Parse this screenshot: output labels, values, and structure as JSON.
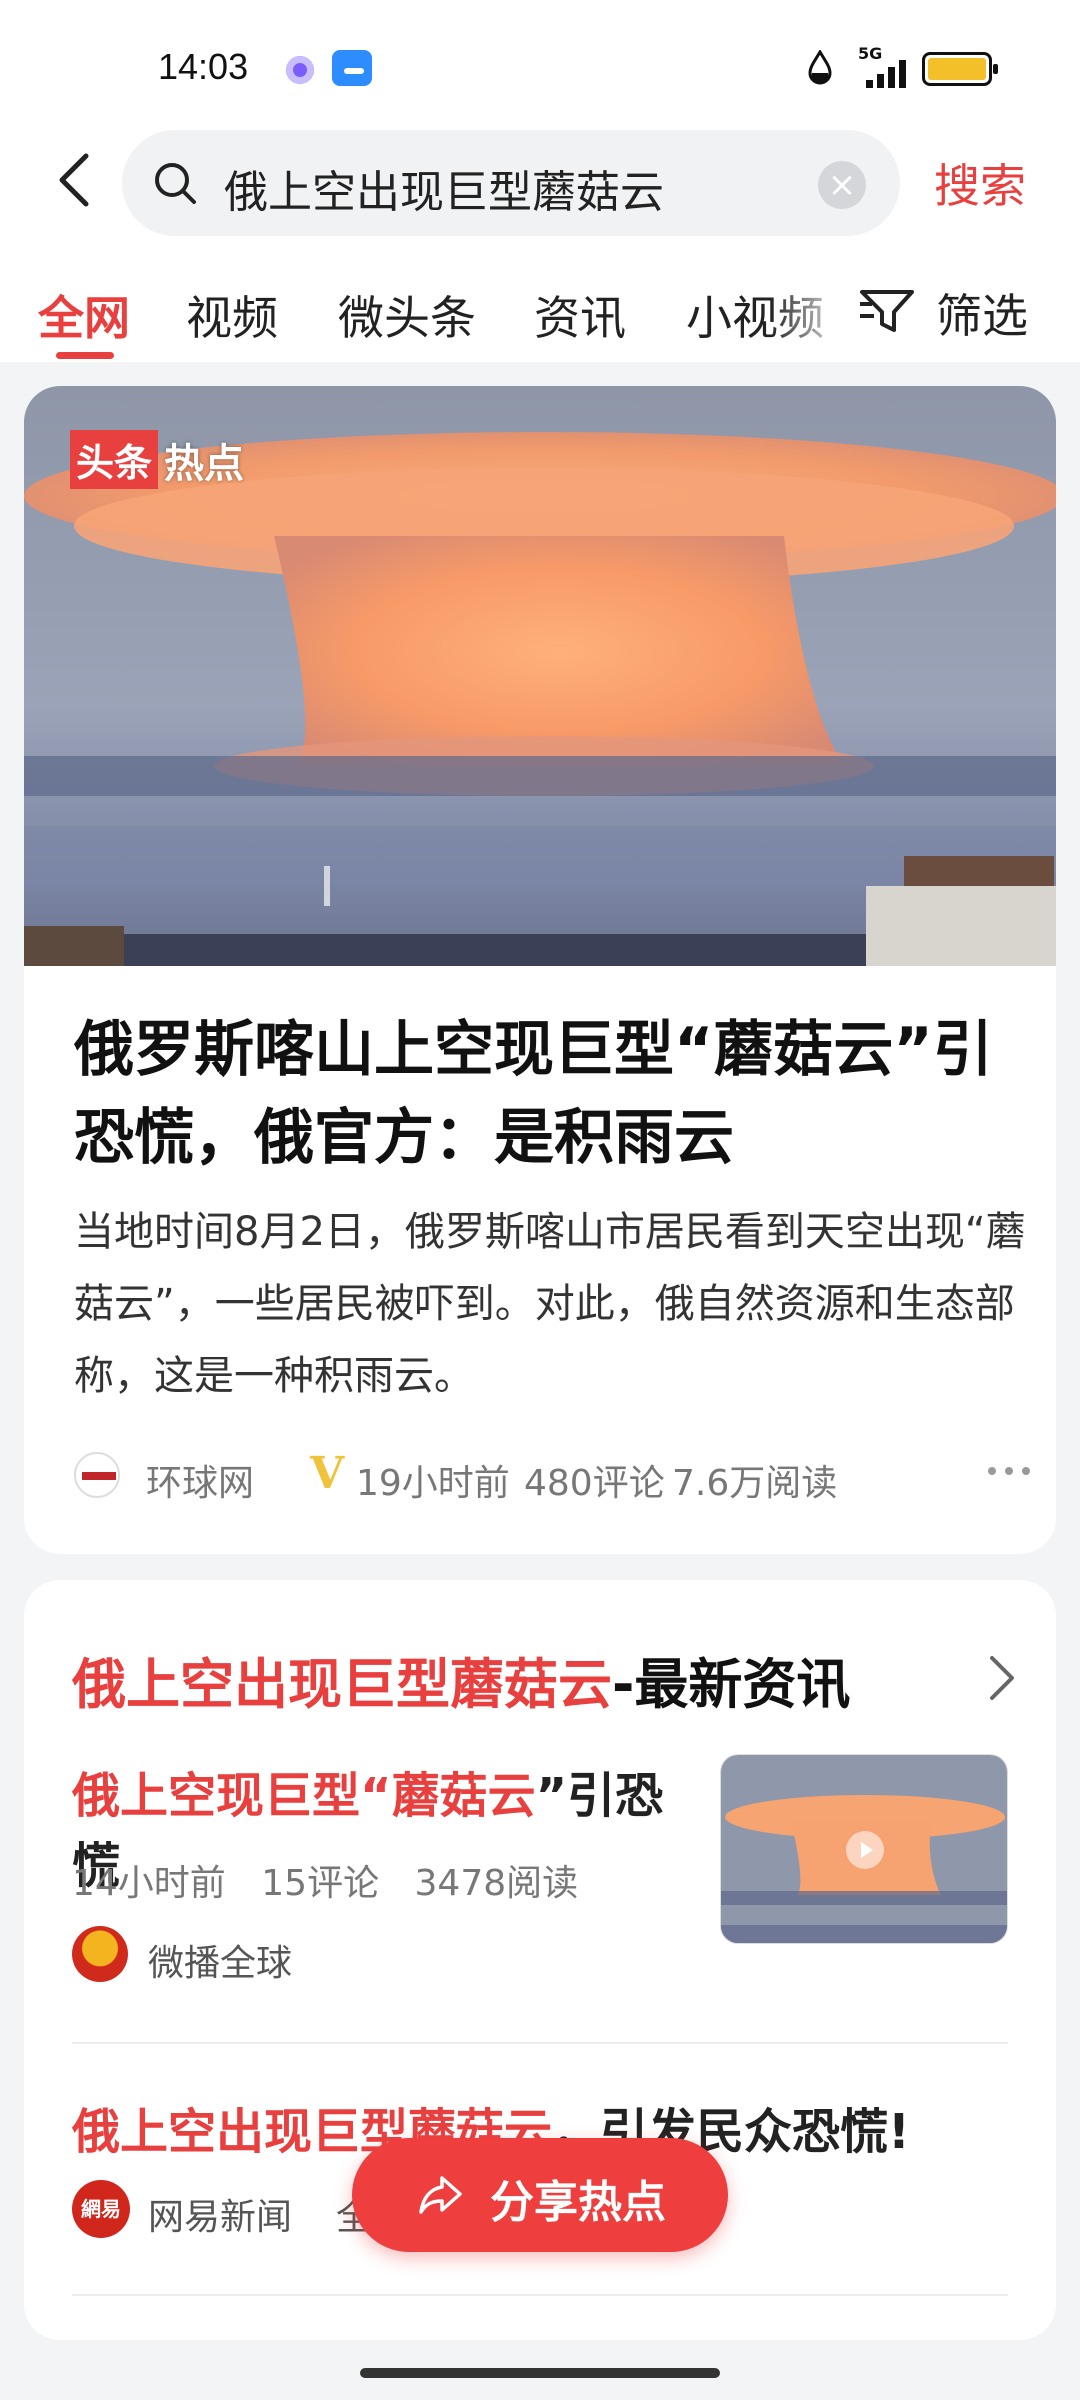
{
  "status_bar": {
    "time": "14:03",
    "network": "5G"
  },
  "search": {
    "query": "俄上空出现巨型蘑菇云",
    "button_label": "搜索"
  },
  "tabs": [
    {
      "label": "全网",
      "active": true
    },
    {
      "label": "视频"
    },
    {
      "label": "微头条"
    },
    {
      "label": "资讯"
    },
    {
      "label": "小视频"
    }
  ],
  "filter_label": "筛选",
  "top_card": {
    "tag_primary": "头条",
    "tag_secondary": "热点",
    "headline": "俄罗斯喀山上空现巨型“蘑菇云”引恐慌，俄官方：是积雨云",
    "summary": "当地时间8月2日，俄罗斯喀山市居民看到天空出现“蘑菇云”，一些居民被吓到。对此，俄自然资源和生态部称，这是一种积雨云。",
    "source": "环球网",
    "time": "19小时前",
    "comments": "480评论",
    "reads": "7.6万阅读"
  },
  "news_section": {
    "title_highlight": "俄上空出现巨型蘑菇云",
    "title_rest": "-最新资讯",
    "items": [
      {
        "title_part1": "俄上空现巨型“",
        "title_part2": "蘑菇云",
        "title_part3": "”引恐慌",
        "time": "14小时前",
        "comments": "15评论",
        "reads": "3478阅读",
        "source": "微播全球"
      },
      {
        "title_highlight": "俄上空出现巨型蘑菇云",
        "title_rest": "，引发民众恐慌!",
        "source": "网易新闻",
        "source_logo_text": "網易",
        "extra": "全网"
      }
    ]
  },
  "share_button_label": "分享热点",
  "colors": {
    "accent": "#e8403f",
    "tag_yellow": "#f0c33c"
  }
}
